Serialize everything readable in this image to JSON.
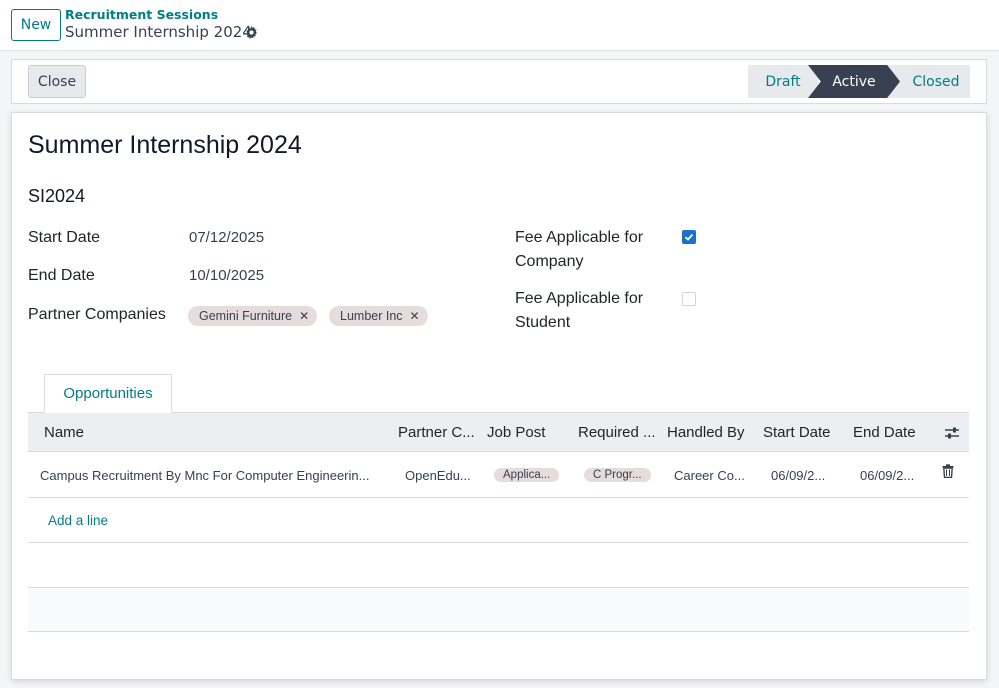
{
  "header": {
    "new_label": "New",
    "breadcrumb_parent": "Recruitment Sessions",
    "breadcrumb_current": "Summer Internship 2024",
    "gear_icon": "gear-icon"
  },
  "statusbar": {
    "close_label": "Close",
    "stages": [
      "Draft",
      "Active",
      "Closed"
    ],
    "current_stage": "Active"
  },
  "form": {
    "title": "Summer Internship 2024",
    "code": "SI2024",
    "start_date_label": "Start Date",
    "start_date": "07/12/2025",
    "end_date_label": "End Date",
    "end_date": "10/10/2025",
    "partner_companies_label": "Partner Companies",
    "partner_companies": [
      "Gemini Furniture",
      "Lumber Inc"
    ],
    "fee_company_label_1": "Fee Applicable for",
    "fee_company_label_2": "Company",
    "fee_company_checked": true,
    "fee_student_label_1": "Fee Applicable for",
    "fee_student_label_2": "Student",
    "fee_student_checked": false
  },
  "tabs": {
    "opportunities": "Opportunities"
  },
  "table": {
    "columns": [
      "Name",
      "Partner C...",
      "Job Post",
      "Required ...",
      "Handled By",
      "Start Date",
      "End Date"
    ],
    "rows": [
      {
        "name": "Campus Recruitment By Mnc For Computer Engineerin...",
        "partner": "OpenEdu...",
        "job_post": "Applica...",
        "required": "C Progr...",
        "handled_by": "Career Co...",
        "start_date": "06/09/2...",
        "end_date": "06/09/2..."
      }
    ],
    "add_line": "Add a line"
  },
  "colors": {
    "accent": "#017e84",
    "active_stage": "#374151",
    "checkbox": "#1a73c8",
    "tag_bg": "#e6dcdc"
  }
}
